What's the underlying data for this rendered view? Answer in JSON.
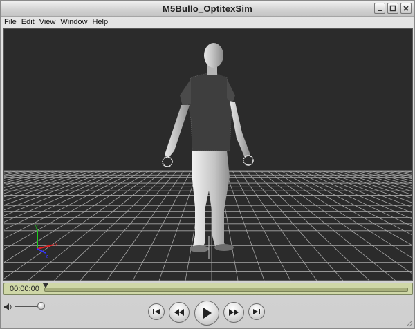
{
  "window": {
    "title": "M5Bullo_OptitexSim"
  },
  "menu": [
    "File",
    "Edit",
    "View",
    "Window",
    "Help"
  ],
  "viewport": {
    "background": "#2b2b2b",
    "grid_color": "#bdbdbd",
    "axes": {
      "x": "#d22",
      "y": "#2c2",
      "z": "#33f"
    }
  },
  "timeline": {
    "timecode": "00:00:00",
    "progress": 0.0
  },
  "transport": {
    "buttons": [
      "skip-to-start-icon",
      "rewind-icon",
      "play-icon",
      "fast-forward-icon",
      "skip-to-end-icon"
    ]
  },
  "volume": {
    "level": 1.0
  },
  "colors": {
    "timeline_bg": "#cfd7a7",
    "chrome": "#d8d8d8"
  }
}
